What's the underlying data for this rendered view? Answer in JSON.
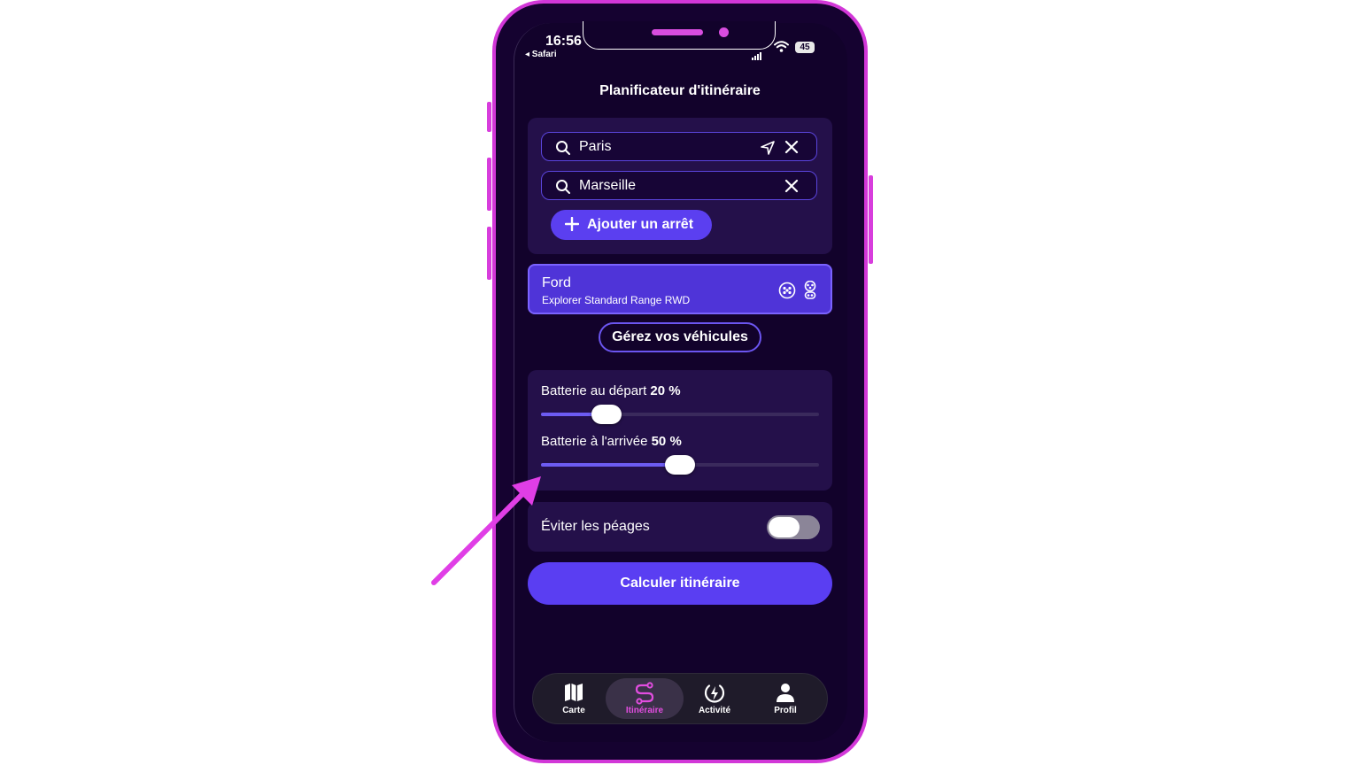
{
  "status_bar": {
    "time": "16:56",
    "back_app": "◂ Safari",
    "battery": "45"
  },
  "page": {
    "title": "Planificateur d'itinéraire"
  },
  "route": {
    "origin": "Paris",
    "destination": "Marseille",
    "add_stop_label": "Ajouter un arrêt"
  },
  "vehicle": {
    "brand": "Ford",
    "model": "Explorer Standard Range RWD",
    "manage_label": "Gérez vos véhicules"
  },
  "battery": {
    "start_label": "Batterie au départ",
    "start_value": "20 %",
    "start_percent": 20,
    "arrival_label": "Batterie à l'arrivée",
    "arrival_value": "50 %",
    "arrival_percent": 50
  },
  "options": {
    "avoid_tolls_label": "Éviter les péages",
    "avoid_tolls_enabled": false
  },
  "actions": {
    "calculate_label": "Calculer itinéraire"
  },
  "tabbar": {
    "items": [
      {
        "label": "Carte",
        "icon": "map-icon",
        "active": false
      },
      {
        "label": "Itinéraire",
        "icon": "route-icon",
        "active": true
      },
      {
        "label": "Activité",
        "icon": "bolt-icon",
        "active": false
      },
      {
        "label": "Profil",
        "icon": "person-icon",
        "active": false
      }
    ]
  },
  "colors": {
    "frame": "#d237d8",
    "accent": "#5a3ef2",
    "background": "#12022b",
    "active_tab": "#e14ddf",
    "annotation_arrow": "#e03ee6"
  }
}
